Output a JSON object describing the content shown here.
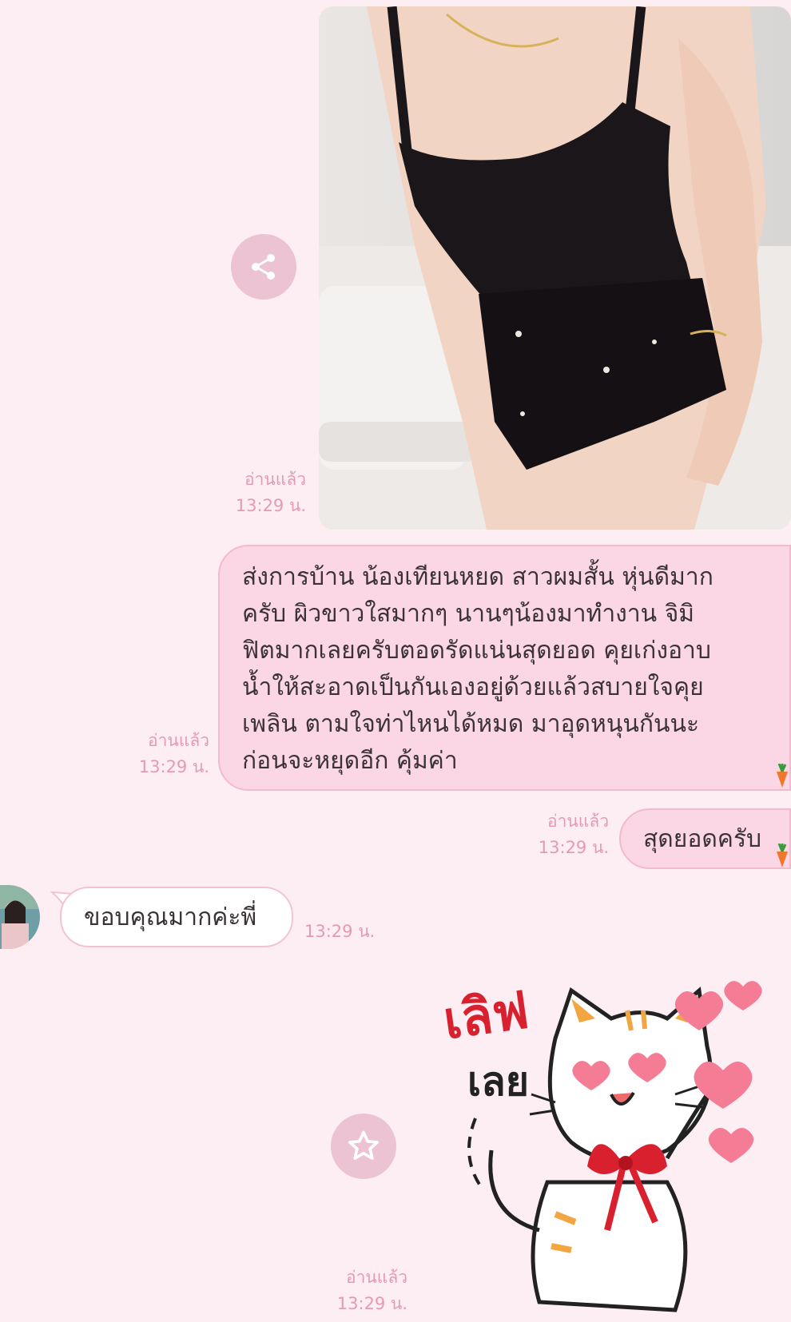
{
  "messages": {
    "photo": {
      "read_label": "อ่านแล้ว",
      "time": "13:29 น."
    },
    "long_text": {
      "lines": [
        "ส่งการบ้าน น้องเทียนหยด สาวผมสั้น หุ่นดีมาก",
        "ครับ ผิวขาวใสมากๆ  นานๆน้องมาทำงาน จิมิ",
        "ฟิตมากเลยครับตอดรัดแน่นสุดยอด คุยเก่งอาบ",
        "น้ำให้สะอาดเป็นกันเองอยู่ด้วยแล้วสบายใจคุย",
        "เพลิน ตามใจท่าไหนได้หมด มาอุดหนุนกันนะ",
        "ก่อนจะหยุดอีก  คุ้มค่า"
      ],
      "read_label": "อ่านแล้ว",
      "time": "13:29 น."
    },
    "short_out": {
      "text": "สุดยอดครับ",
      "read_label": "อ่านแล้ว",
      "time": "13:29 น."
    },
    "incoming": {
      "text": "ขอบคุณมากค่ะพี่",
      "time": "13:29 น."
    },
    "sticker": {
      "line1": "เลิฟ",
      "line2": "เลย",
      "read_label": "อ่านแล้ว",
      "time": "13:29 น."
    }
  },
  "icons": {
    "share": "share-icon",
    "star": "star-icon",
    "reaction": "carrot-icon"
  },
  "colors": {
    "background": "#fdeef3",
    "outgoing_bubble": "#fbd7e5",
    "meta_text": "#e59ab3",
    "action_button": "#ecc3d2",
    "sticker_red": "#d9202f"
  }
}
